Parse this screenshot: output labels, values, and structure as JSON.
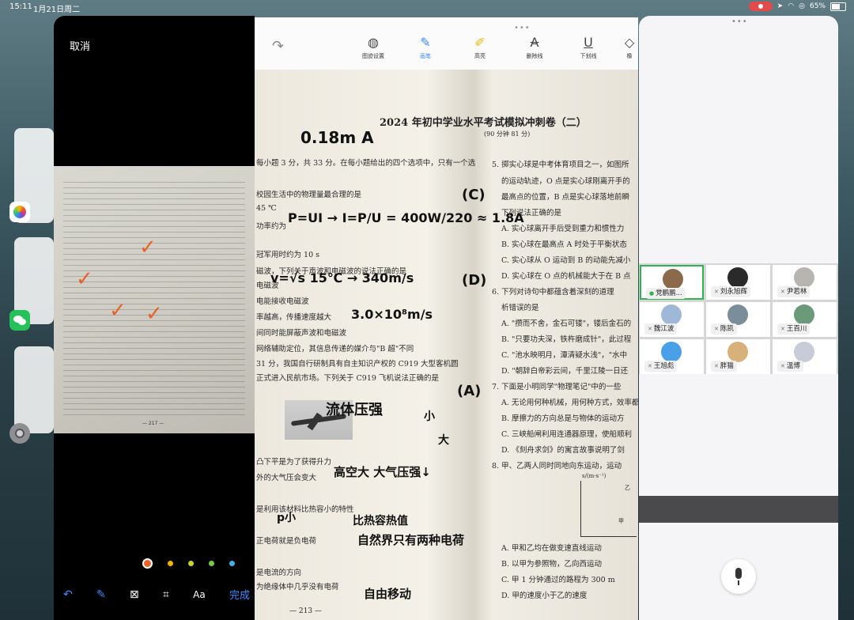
{
  "status_bar": {
    "time": "15:11",
    "date": "1月21日周二",
    "battery": "65%"
  },
  "editor": {
    "cancel_label": "取消",
    "photo_page_number": "— 217 —",
    "colors": [
      "#e8622a",
      "#f0b400",
      "#c8d32a",
      "#7ac943",
      "#3fb0e8"
    ],
    "tools": {
      "text_tool": "Aa",
      "done_label": "完成"
    }
  },
  "document": {
    "toolbar": [
      {
        "label": "图迹设置",
        "icon": "palette-icon"
      },
      {
        "label": "画笔",
        "icon": "pen-icon",
        "active": true
      },
      {
        "label": "高亮",
        "icon": "highlighter-icon"
      },
      {
        "label": "删除线",
        "icon": "strikethrough-icon"
      },
      {
        "label": "下划线",
        "icon": "underline-icon"
      },
      {
        "label": "橡",
        "icon": "eraser-icon"
      }
    ],
    "paper": {
      "title": "2024 年初中学业水平考试模拟冲刺卷（二）",
      "subtitle": "(90 分钟   81 分)",
      "page_number": "— 213 —",
      "left_column": [
        "每小题 3 分，共 33 分。在每小题给出的四个选项中，只有一个选",
        "校园生活中的物理量最合理的是",
        "45 ℃",
        "功率约为",
        "冠军用时约为 10 s",
        "磁波，下列关于声波和电磁波的说法正确的是",
        "电磁波",
        "电能接收电磁波",
        "率越高，传播速度越大",
        "间同时能屏蔽声波和电磁波",
        "网络辅助定位，其信息传递的媒介与\"B 超\"不同",
        "31 分，我国自行研制具有自主知识产权的 C919 大型客机圆",
        "正式进入民航市场。下列关于 C919 飞机说法正确的是",
        "凸下平是为了获得升力",
        "外的大气压会变大",
        "是利用该材料比热容小的特性",
        "正电荷就是负电荷",
        "是电流的方向",
        "为绝缘体中几乎没有电荷"
      ],
      "right_column": [
        "5. 掷实心球是中考体育项目之一，如图所",
        "的运动轨迹，O 点是实心球刚离开手的",
        "最高点的位置，B 点是实心球落地前瞬",
        "下列说法正确的是",
        "A. 实心球离开手后受到重力和惯性力",
        "B. 实心球在最高点 A 时处于平衡状态",
        "C. 实心球从 O 运动到 B 的动能先减小",
        "D. 实心球在 O 点的机械能大于在 B 点",
        "6. 下列对诗句中都蕴含着深刻的道理",
        "析错误的是",
        "A. \"攒而不舍，金石可镂\"，镂后金石的",
        "B. \"只要功夫深，铁杵磨成针\"，此过程",
        "C. \"池水映明月，潭清疑水浅\"，\"水中",
        "D. \"朝辞白帝彩云间，千里江陵一日还",
        "7. 下面是小明同学\"物理笔记\"中的一些",
        "A. 无论用何种机械，用何种方式，效率都",
        "B. 摩擦力的方向总是与物体的运动方",
        "C. 三峡船闸利用连通器原理，使船顺利",
        "D. 《刻舟求剑》的寓言故事说明了剑",
        "8. 甲、乙两人同时同地向东运动，运动",
        "A. 甲和乙均在做变速直线运动",
        "B. 以甲为参照物，乙向西运动",
        "C. 甲 1 分钟通过的路程为 300 m",
        "D. 甲的速度小于乙的速度"
      ],
      "handwriting": [
        "0.18m A",
        "P=UI → I=P/U = 400W/220 ≈ 1.8A",
        "(C)",
        "v=√s 15℃ → 340m/s",
        "(D)",
        "3.0×10⁸m/s",
        "流体压强",
        "(A)",
        "小",
        "大",
        "高空大   大气压强↓",
        "p小",
        "比热容热值",
        "自然界只有两种电荷",
        "自由移动"
      ],
      "graph": {
        "y_label": "s/(m·s⁻¹)",
        "lines": [
          "乙",
          "甲"
        ]
      }
    }
  },
  "meeting": {
    "participants": [
      {
        "name": "党鹏鹏...",
        "highlight": true,
        "avatar_color": "#8a6a4a",
        "mic": "green"
      },
      {
        "name": "刘永旭辉",
        "avatar_color": "#2a2a2a"
      },
      {
        "name": "尹若林",
        "avatar_color": "#b8b4b0"
      },
      {
        "name": "魏江波",
        "avatar_color": "#9fb8d8"
      },
      {
        "name": "陈凯",
        "avatar_color": "#7a8e9a"
      },
      {
        "name": "王百川",
        "avatar_color": "#6a9a7a"
      },
      {
        "name": "王旭彪",
        "avatar_color": "#4aa0e8"
      },
      {
        "name": "胖猫",
        "avatar_color": "#d8b07a"
      },
      {
        "name": "溫博",
        "avatar_color": "#c8ccd8"
      }
    ]
  }
}
